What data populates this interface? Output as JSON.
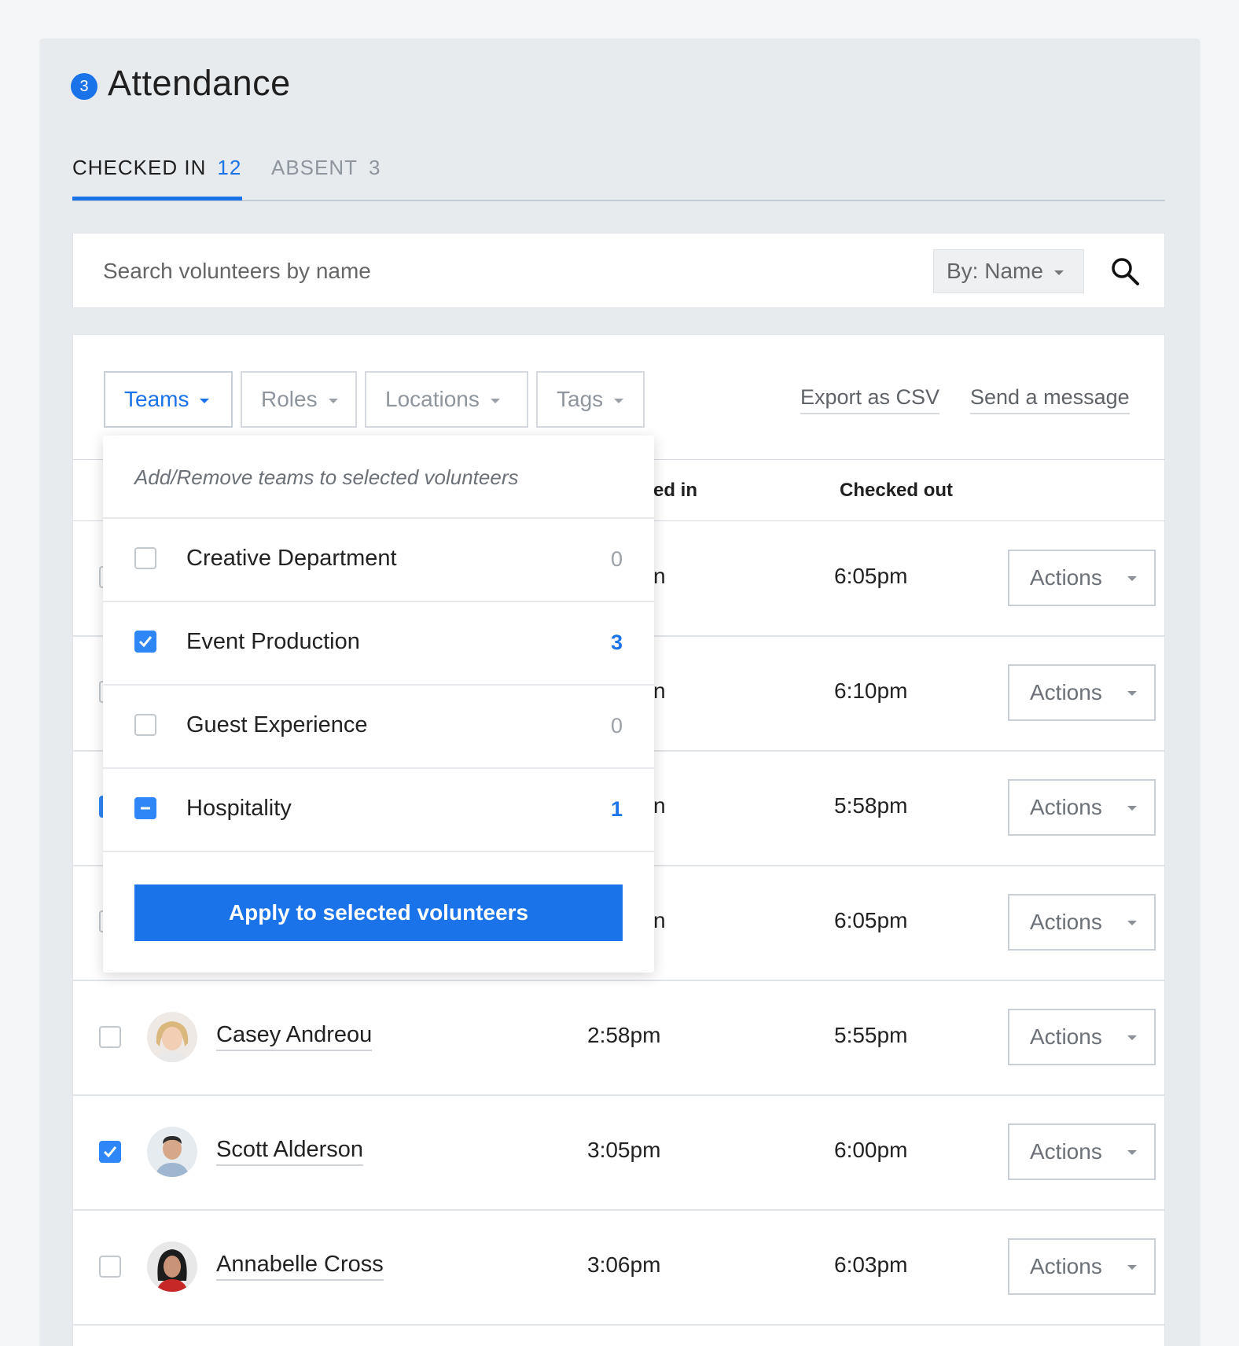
{
  "header": {
    "step_number": "3",
    "title": "Attendance"
  },
  "tabs": [
    {
      "label": "CHECKED IN",
      "count": "12",
      "active": true
    },
    {
      "label": "ABSENT",
      "count": "3",
      "active": false
    }
  ],
  "search": {
    "placeholder": "Search volunteers by name",
    "by_label": "By: Name"
  },
  "filters": [
    {
      "label": "Teams",
      "active": true
    },
    {
      "label": "Roles",
      "active": false
    },
    {
      "label": "Locations",
      "active": false
    },
    {
      "label": "Tags",
      "active": false
    }
  ],
  "links": {
    "export": "Export as CSV",
    "message": "Send a message"
  },
  "columns": {
    "checked_in_partial": "ed in",
    "checked_out": "Checked out"
  },
  "rows": [
    {
      "name": "",
      "checked_in_partial": "n",
      "checked_out": "6:05pm",
      "action": "Actions"
    },
    {
      "name": "",
      "checked_in_partial": "n",
      "checked_out": "6:10pm",
      "action": "Actions"
    },
    {
      "name": "",
      "checked_in_partial": "n",
      "checked_out": "5:58pm",
      "action": "Actions"
    },
    {
      "name": "",
      "checked_in_partial": "n",
      "checked_out": "6:05pm",
      "action": "Actions"
    },
    {
      "name": "Casey Andreou",
      "checked_in": "2:58pm",
      "checked_out": "5:55pm",
      "action": "Actions",
      "selected": false
    },
    {
      "name": "Scott Alderson",
      "checked_in": "3:05pm",
      "checked_out": "6:00pm",
      "action": "Actions",
      "selected": true
    },
    {
      "name": "Annabelle Cross",
      "checked_in": "3:06pm",
      "checked_out": "6:03pm",
      "action": "Actions",
      "selected": false
    }
  ],
  "teams_dropdown": {
    "hint": "Add/Remove teams to selected volunteers",
    "items": [
      {
        "label": "Creative Department",
        "count": "0",
        "state": "unchecked"
      },
      {
        "label": "Event Production",
        "count": "3",
        "state": "checked"
      },
      {
        "label": "Guest Experience",
        "count": "0",
        "state": "unchecked"
      },
      {
        "label": "Hospitality",
        "count": "1",
        "state": "indeterminate"
      }
    ],
    "apply_label": "Apply to selected volunteers"
  },
  "colors": {
    "accent": "#1a73e8",
    "panel": "#e8ebee"
  }
}
